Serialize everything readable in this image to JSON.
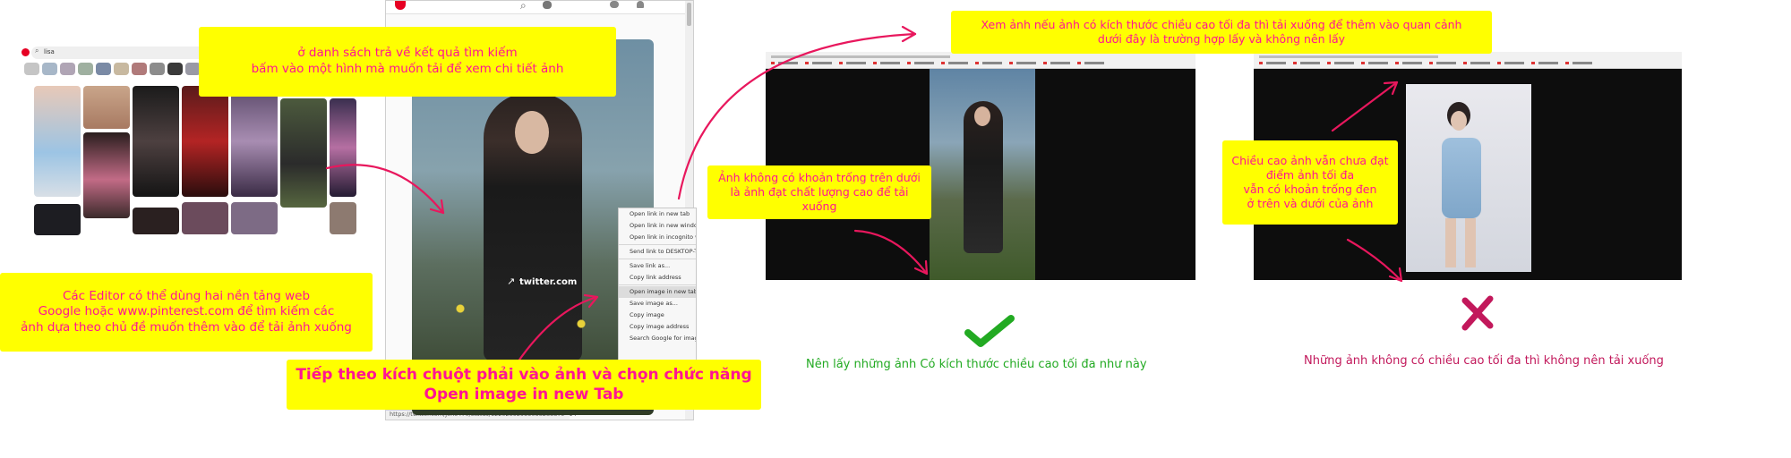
{
  "notes": {
    "search_results": "ở danh sách trả về kết quả tìm kiếm\nbấm vào một hình mà muốn tải để xem chi tiết ảnh",
    "editors": "Các Editor có thể dùng hai nền tảng web\nGoogle hoặc www.pinterest.com để tìm kiếm các\nảnh dựa theo chủ đề muốn thêm vào để tải ảnh xuống",
    "right_click": "Tiếp theo kích chuột phải vào ảnh và chọn chức năng\nOpen image in new Tab",
    "view_size": "Xem ảnh nếu ảnh có kích thước chiều cao tối đa thì tải xuống để thêm vào quan cảnh\ndưới đây là trường hợp lấy và không nên lấy",
    "no_blank": "Ảnh không có khoản trống trên dưới\nlà ảnh đạt chất lượng cao để tải xuống",
    "not_max": "Chiều cao ảnh vẫn chưa đạt\nđiểm ảnh tối đa\nvẫn có khoản trống đen\nở trên và dưới của  ảnh"
  },
  "pinterest": {
    "search_value": "lisa"
  },
  "tweet": {
    "watermark": "twitter.com",
    "status_url": "https://twitter.com/jeno470/status/1220289295505828887s=14"
  },
  "context_menu": {
    "items": [
      "Open link in new tab",
      "Open link in new window",
      "Open link in incognito window",
      "Send link to DESKTOP-T",
      "Save link as...",
      "Copy link address",
      "Open image in new tab",
      "Save image as...",
      "Copy image",
      "Copy image address",
      "Search Google for image"
    ],
    "selected_index": 6
  },
  "verdict": {
    "good": "Nên lấy những ảnh Có kích thước chiều cao tối đa như này",
    "bad": "Những ảnh không có chiều cao tối đa thì không nên tải xuống"
  },
  "colors": {
    "note_bg": "#ffff00",
    "note_text": "#ff1493",
    "arrow": "#e8175d",
    "good": "#22aa22",
    "bad": "#c2185b"
  }
}
